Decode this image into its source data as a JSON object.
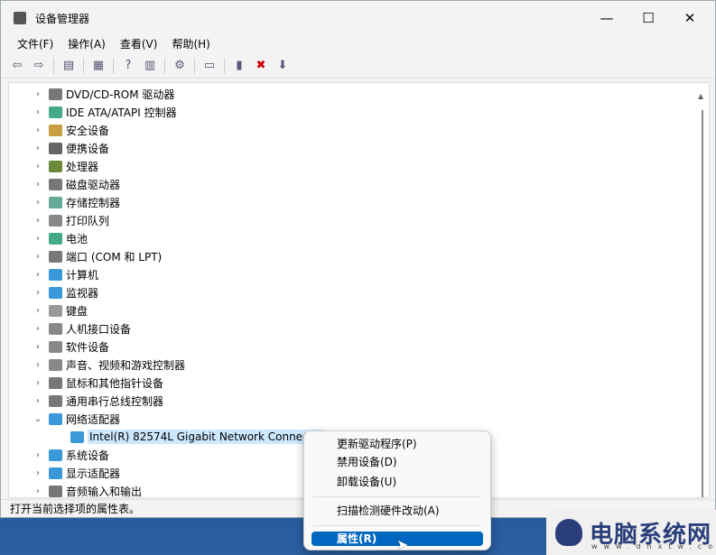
{
  "window": {
    "title": "设备管理器",
    "minimize": "—",
    "maximize": "☐",
    "close": "✕"
  },
  "menu": [
    "文件(F)",
    "操作(A)",
    "查看(V)",
    "帮助(H)"
  ],
  "toolbar": [
    {
      "icon": "back-icon",
      "g": "⇦"
    },
    {
      "icon": "forward-icon",
      "g": "⇨"
    },
    {
      "sep": true
    },
    {
      "icon": "console-tree-icon",
      "g": "▤"
    },
    {
      "sep": true
    },
    {
      "icon": "properties-icon",
      "g": "▦"
    },
    {
      "sep": true
    },
    {
      "icon": "help-icon",
      "g": "?"
    },
    {
      "icon": "action-pane-icon",
      "g": "▥"
    },
    {
      "sep": true
    },
    {
      "icon": "update-driver-icon",
      "g": "⚙"
    },
    {
      "sep": true
    },
    {
      "icon": "scan-hardware-icon",
      "g": "▭"
    },
    {
      "sep": true
    },
    {
      "icon": "add-device-icon",
      "g": "▮"
    },
    {
      "icon": "uninstall-icon",
      "g": "✖",
      "color": "#d00000"
    },
    {
      "icon": "download-icon",
      "g": "⬇"
    }
  ],
  "tree": [
    {
      "label": "DVD/CD-ROM 驱动器",
      "color": "#777"
    },
    {
      "label": "IDE ATA/ATAPI 控制器",
      "color": "#4a8"
    },
    {
      "label": "安全设备",
      "color": "#c9a040"
    },
    {
      "label": "便携设备",
      "color": "#666"
    },
    {
      "label": "处理器",
      "color": "#6a8a3a"
    },
    {
      "label": "磁盘驱动器",
      "color": "#777"
    },
    {
      "label": "存储控制器",
      "color": "#6a9"
    },
    {
      "label": "打印队列",
      "color": "#888"
    },
    {
      "label": "电池",
      "color": "#4a8"
    },
    {
      "label": "端口 (COM 和 LPT)",
      "color": "#777"
    },
    {
      "label": "计算机",
      "color": "#3a9ad9"
    },
    {
      "label": "监视器",
      "color": "#3a9ad9"
    },
    {
      "label": "键盘",
      "color": "#999"
    },
    {
      "label": "人机接口设备",
      "color": "#888"
    },
    {
      "label": "软件设备",
      "color": "#888"
    },
    {
      "label": "声音、视频和游戏控制器",
      "color": "#888"
    },
    {
      "label": "鼠标和其他指针设备",
      "color": "#777"
    },
    {
      "label": "通用串行总线控制器",
      "color": "#777"
    },
    {
      "label": "网络适配器",
      "color": "#3a9ad9",
      "expanded": true
    },
    {
      "label": "Intel(R) 82574L Gigabit Network Connectio",
      "color": "#3a9ad9",
      "child": true,
      "selected": true
    },
    {
      "label": "系统设备",
      "color": "#3a9ad9"
    },
    {
      "label": "显示适配器",
      "color": "#3a9ad9"
    },
    {
      "label": "音频输入和输出",
      "color": "#777"
    }
  ],
  "status": "打开当前选择项的属性表。",
  "context_menu": {
    "items": [
      "更新驱动程序(P)",
      "禁用设备(D)",
      "卸载设备(U)",
      "扫描检测硬件改动(A)"
    ],
    "highlighted": "属性(R)"
  },
  "watermark": {
    "name": "电脑系统网",
    "url": "www.dnxtw.com"
  }
}
